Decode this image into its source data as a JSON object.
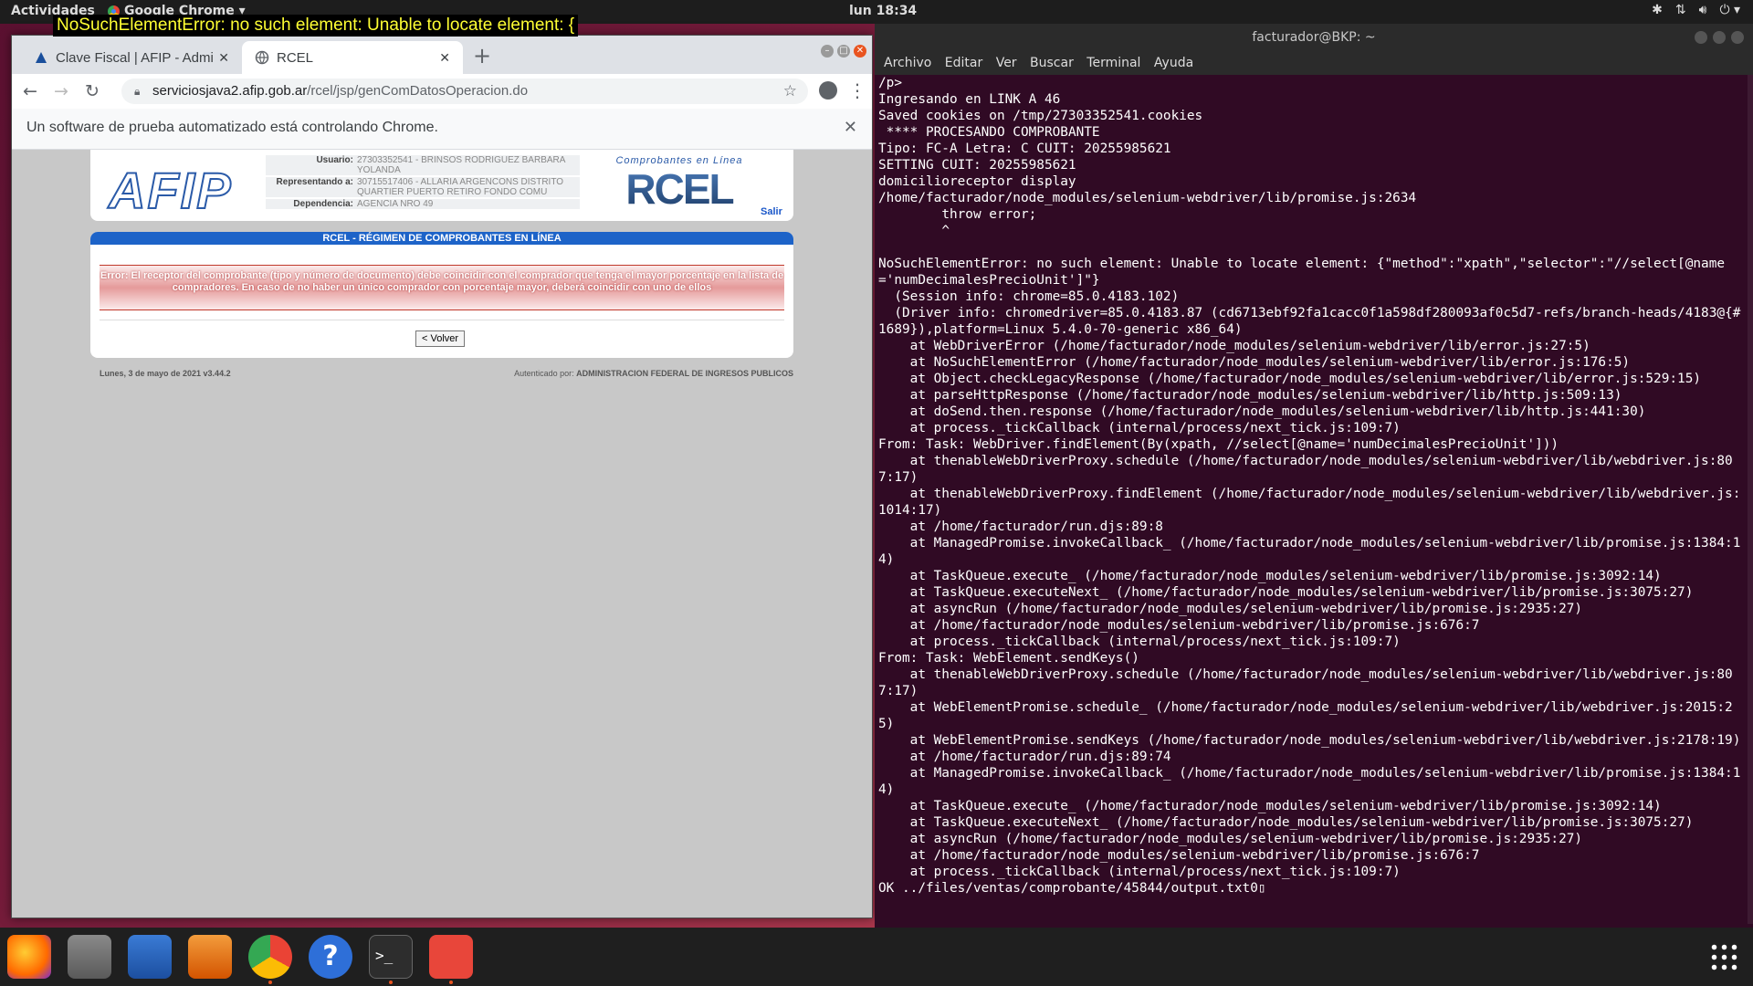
{
  "topbar": {
    "activities": "Actividades",
    "app_menu": "Google Chrome ▾",
    "clock": "lun 18:34"
  },
  "error_tooltip": "NoSuchElementError: no such element: Unable to locate element: {",
  "chrome": {
    "tabs": [
      {
        "title": "Clave Fiscal | AFIP - Admin",
        "active": false
      },
      {
        "title": "RCEL",
        "active": true
      }
    ],
    "url_host": "serviciosjava2.afip.gob.ar",
    "url_path": "/rcel/jsp/genComDatosOperacion.do",
    "infobar": "Un software de prueba automatizado está controlando Chrome."
  },
  "afip": {
    "logo": "AFIP",
    "usuario_label": "Usuario:",
    "usuario_value": "27303352541 - BRINSOS RODRIGUEZ BARBARA YOLANDA",
    "representando_label": "Representando a:",
    "representando_value": "30715517406 - ALLARIA ARGENCONS DISTRITO QUARTIER PUERTO RETIRO FONDO COMU",
    "dependencia_label": "Dependencia:",
    "dependencia_value": "AGENCIA NRO 49",
    "rcel_caption": "Comprobantes en Línea",
    "rcel_logo": "RCEL",
    "salir": "Salir",
    "title": "RCEL - RÉGIMEN DE COMPROBANTES EN LÍNEA",
    "error": "Error: El receptor del comprobante (tipo y número de documento) debe coincidir con el comprador que tenga el mayor porcentaje en la lista de compradores. En caso de no haber un único comprador con porcentaje mayor, deberá coincidir con uno de ellos",
    "volver": "< Volver",
    "footer_left": "Lunes, 3 de mayo de 2021 v3.44.2",
    "footer_right_prefix": "Autenticado por: ",
    "footer_right_org": "ADMINISTRACION FEDERAL DE INGRESOS PUBLICOS"
  },
  "terminal": {
    "title": "facturador@BKP: ~",
    "menu": [
      "Archivo",
      "Editar",
      "Ver",
      "Buscar",
      "Terminal",
      "Ayuda"
    ],
    "output": "/p>\nIngresando en LINK A 46\nSaved cookies on /tmp/27303352541.cookies\n **** PROCESANDO COMPROBANTE\nTipo: FC-A Letra: C CUIT: 20255985621\nSETTING CUIT: 20255985621\ndomicilioreceptor display\n/home/facturador/node_modules/selenium-webdriver/lib/promise.js:2634\n        throw error;\n        ^\n\nNoSuchElementError: no such element: Unable to locate element: {\"method\":\"xpath\",\"selector\":\"//select[@name='numDecimalesPrecioUnit']\"}\n  (Session info: chrome=85.0.4183.102)\n  (Driver info: chromedriver=85.0.4183.87 (cd6713ebf92fa1cacc0f1a598df280093af0c5d7-refs/branch-heads/4183@{#1689}),platform=Linux 5.4.0-70-generic x86_64)\n    at WebDriverError (/home/facturador/node_modules/selenium-webdriver/lib/error.js:27:5)\n    at NoSuchElementError (/home/facturador/node_modules/selenium-webdriver/lib/error.js:176:5)\n    at Object.checkLegacyResponse (/home/facturador/node_modules/selenium-webdriver/lib/error.js:529:15)\n    at parseHttpResponse (/home/facturador/node_modules/selenium-webdriver/lib/http.js:509:13)\n    at doSend.then.response (/home/facturador/node_modules/selenium-webdriver/lib/http.js:441:30)\n    at process._tickCallback (internal/process/next_tick.js:109:7)\nFrom: Task: WebDriver.findElement(By(xpath, //select[@name='numDecimalesPrecioUnit']))\n    at thenableWebDriverProxy.schedule (/home/facturador/node_modules/selenium-webdriver/lib/webdriver.js:807:17)\n    at thenableWebDriverProxy.findElement (/home/facturador/node_modules/selenium-webdriver/lib/webdriver.js:1014:17)\n    at /home/facturador/run.djs:89:8\n    at ManagedPromise.invokeCallback_ (/home/facturador/node_modules/selenium-webdriver/lib/promise.js:1384:14)\n    at TaskQueue.execute_ (/home/facturador/node_modules/selenium-webdriver/lib/promise.js:3092:14)\n    at TaskQueue.executeNext_ (/home/facturador/node_modules/selenium-webdriver/lib/promise.js:3075:27)\n    at asyncRun (/home/facturador/node_modules/selenium-webdriver/lib/promise.js:2935:27)\n    at /home/facturador/node_modules/selenium-webdriver/lib/promise.js:676:7\n    at process._tickCallback (internal/process/next_tick.js:109:7)\nFrom: Task: WebElement.sendKeys()\n    at thenableWebDriverProxy.schedule (/home/facturador/node_modules/selenium-webdriver/lib/webdriver.js:807:17)\n    at WebElementPromise.schedule_ (/home/facturador/node_modules/selenium-webdriver/lib/webdriver.js:2015:25)\n    at WebElementPromise.sendKeys (/home/facturador/node_modules/selenium-webdriver/lib/webdriver.js:2178:19)\n    at /home/facturador/run.djs:89:74\n    at ManagedPromise.invokeCallback_ (/home/facturador/node_modules/selenium-webdriver/lib/promise.js:1384:14)\n    at TaskQueue.execute_ (/home/facturador/node_modules/selenium-webdriver/lib/promise.js:3092:14)\n    at TaskQueue.executeNext_ (/home/facturador/node_modules/selenium-webdriver/lib/promise.js:3075:27)\n    at asyncRun (/home/facturador/node_modules/selenium-webdriver/lib/promise.js:2935:27)\n    at /home/facturador/node_modules/selenium-webdriver/lib/promise.js:676:7\n    at process._tickCallback (internal/process/next_tick.js:109:7)\nOK ../files/ventas/comprobante/45844/output.txt0▯"
  },
  "dock": {
    "apps": [
      "firefox-icon",
      "files-icon",
      "writer-icon",
      "software-icon",
      "chrome-icon",
      "help-icon",
      "terminal-icon",
      "git-icon"
    ]
  }
}
